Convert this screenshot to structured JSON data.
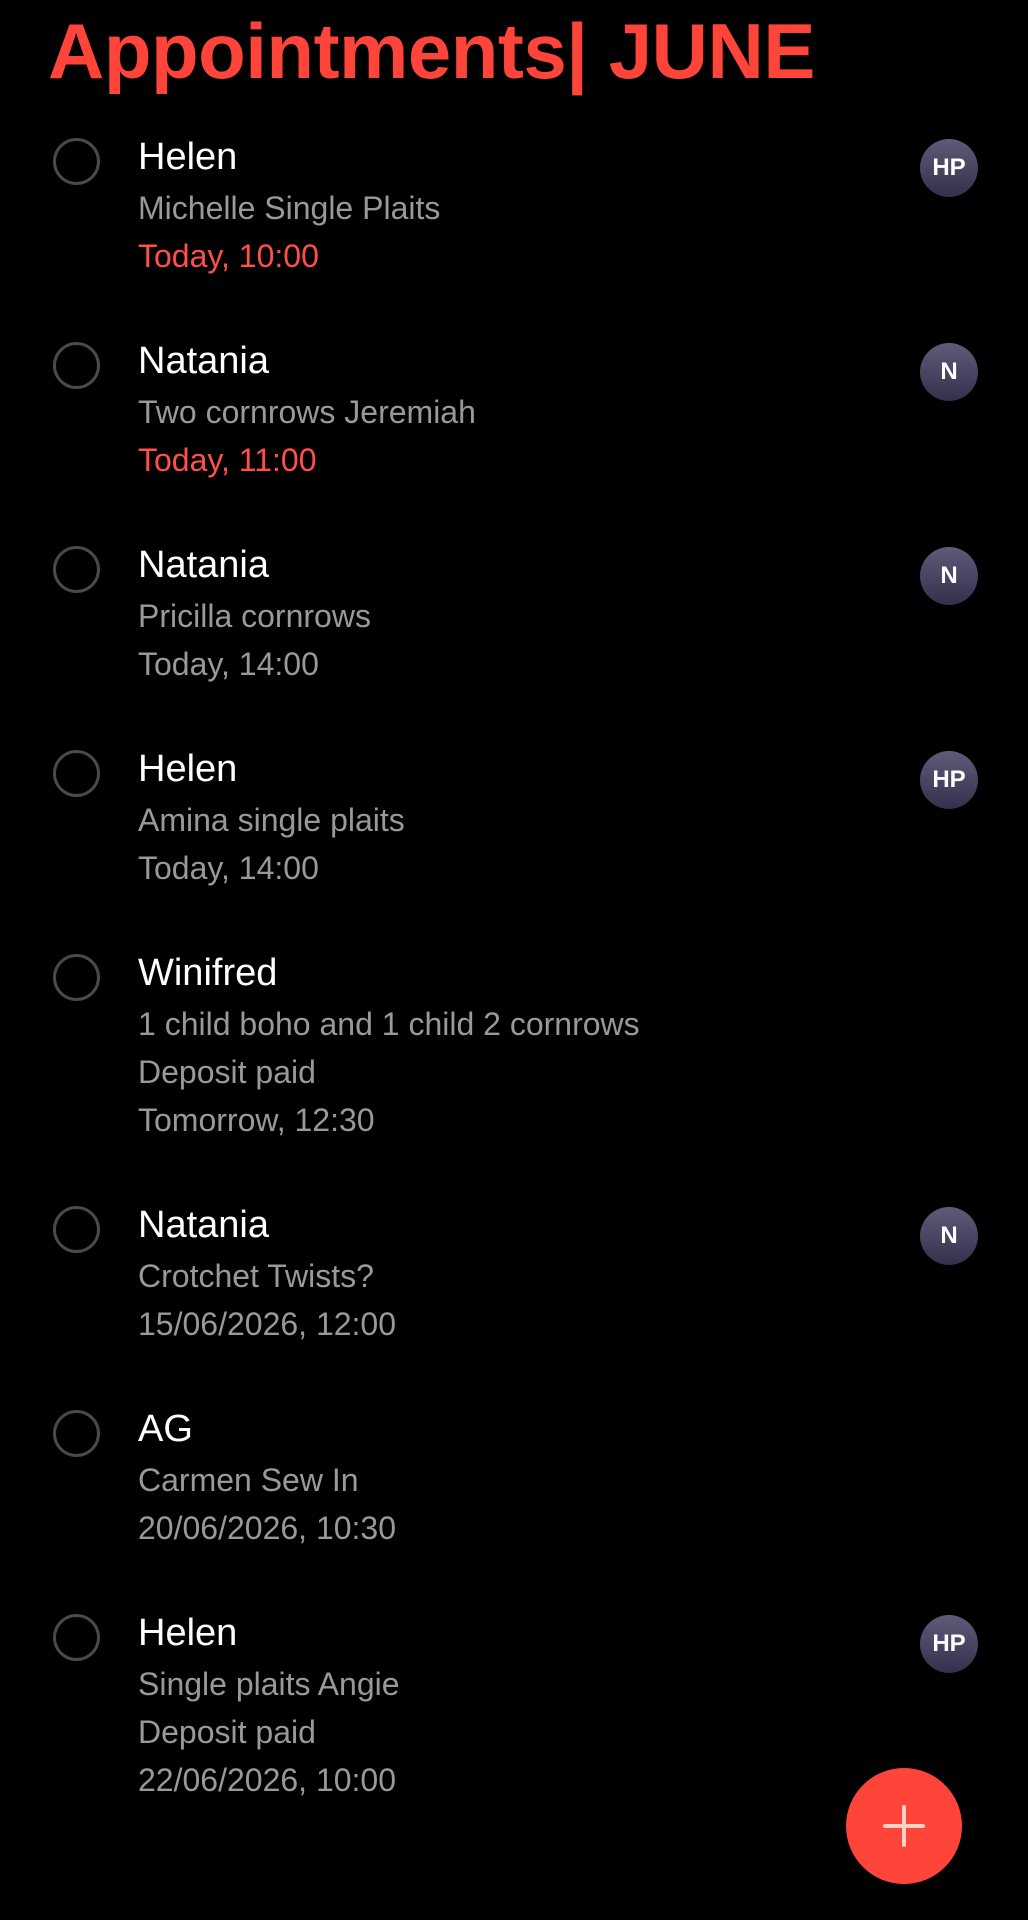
{
  "title": "Appointments| JUNE",
  "colors": {
    "accent": "#ff453a",
    "overdue": "#ff4f4b",
    "secondary_text": "#98989d",
    "background": "#000000"
  },
  "appointments": [
    {
      "name": "Helen",
      "lines": [
        "Michelle Single Plaits"
      ],
      "when": "Today, 10:00",
      "overdue": true,
      "avatar": "HP"
    },
    {
      "name": "Natania",
      "lines": [
        "Two cornrows Jeremiah"
      ],
      "when": "Today, 11:00",
      "overdue": true,
      "avatar": "N"
    },
    {
      "name": "Natania",
      "lines": [
        "Pricilla cornrows"
      ],
      "when": "Today, 14:00",
      "overdue": false,
      "avatar": "N"
    },
    {
      "name": "Helen",
      "lines": [
        "Amina single plaits"
      ],
      "when": "Today, 14:00",
      "overdue": false,
      "avatar": "HP"
    },
    {
      "name": "Winifred",
      "lines": [
        "1 child boho and 1 child 2 cornrows",
        "Deposit paid"
      ],
      "when": "Tomorrow, 12:30",
      "overdue": false,
      "avatar": ""
    },
    {
      "name": "Natania",
      "lines": [
        "Crotchet Twists?"
      ],
      "when": "15/06/2026, 12:00",
      "overdue": false,
      "avatar": "N"
    },
    {
      "name": "AG",
      "lines": [
        "Carmen Sew In"
      ],
      "when": "20/06/2026, 10:30",
      "overdue": false,
      "avatar": ""
    },
    {
      "name": "Helen",
      "lines": [
        "Single plaits Angie",
        "Deposit paid"
      ],
      "when": "22/06/2026, 10:00",
      "overdue": false,
      "avatar": "HP"
    }
  ],
  "fab": {
    "icon": "plus-icon"
  }
}
